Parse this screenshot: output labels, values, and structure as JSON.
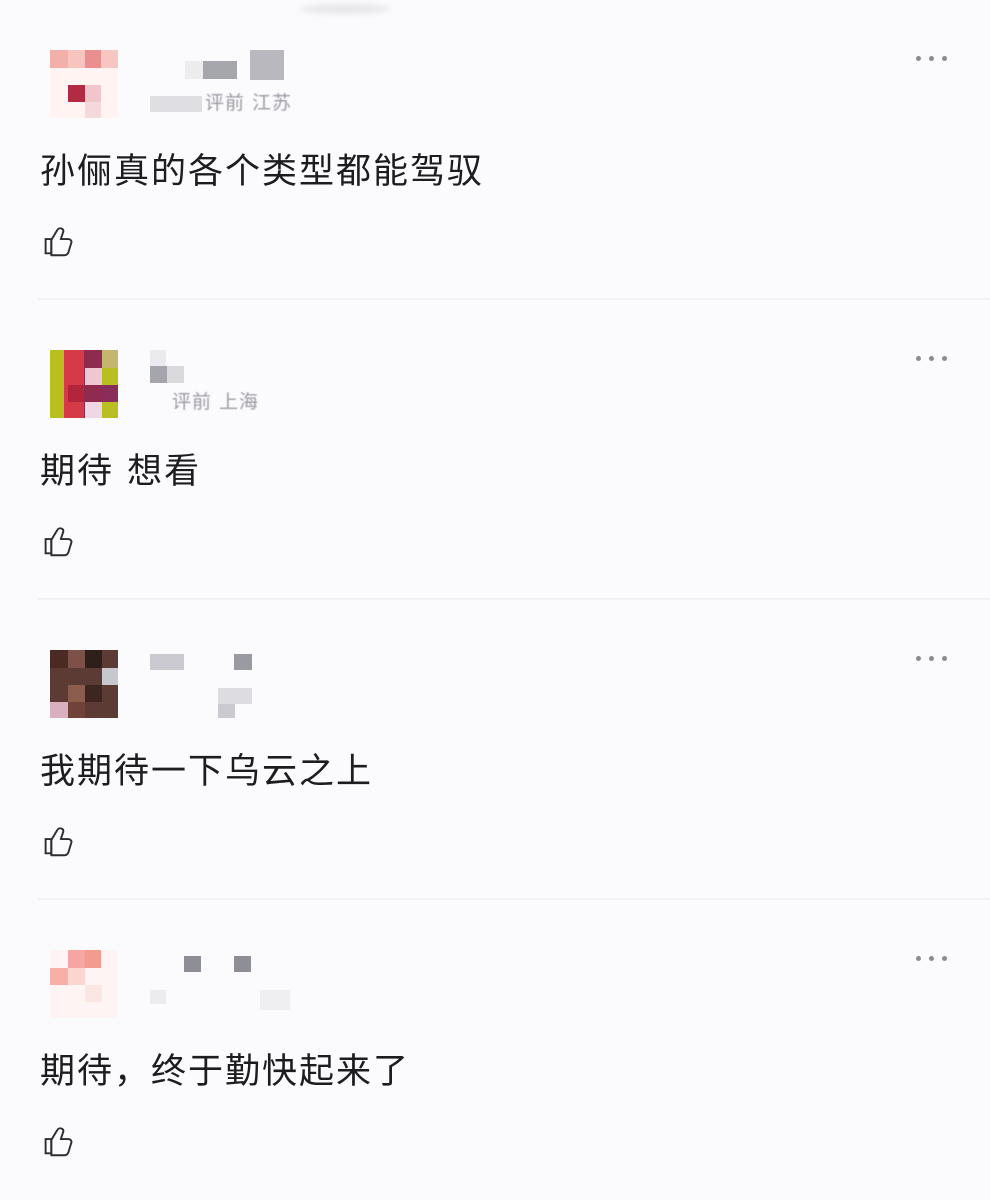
{
  "comments": [
    {
      "meta_text": "评前 江苏",
      "comment_text": "孙俪真的各个类型都能驾驭"
    },
    {
      "meta_text": "评前 上海",
      "comment_text": "期待 想看"
    },
    {
      "meta_text": "",
      "comment_text": "我期待一下乌云之上"
    },
    {
      "meta_text": "",
      "comment_text": "期待，终于勤快起来了"
    }
  ]
}
